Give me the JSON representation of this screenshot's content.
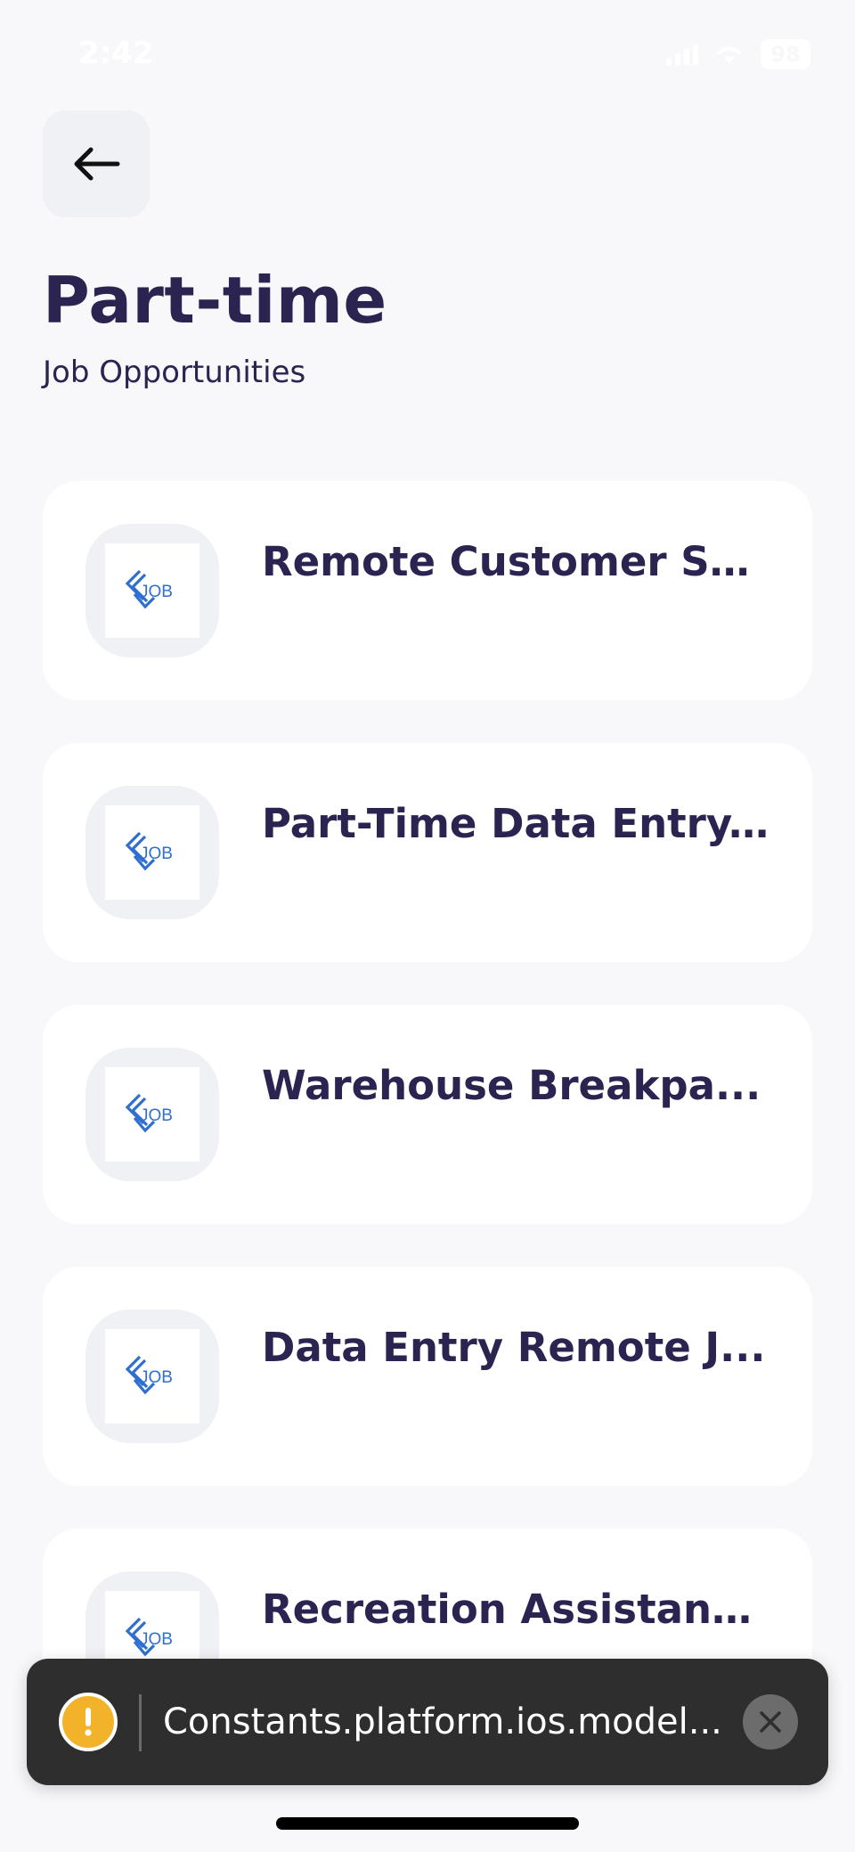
{
  "status_bar": {
    "time": "2:42",
    "battery": "98"
  },
  "header": {
    "title": "Part-time",
    "subtitle": "Job Opportunities"
  },
  "jobs": [
    {
      "title": "Remote Customer Se...",
      "logo": "JOB"
    },
    {
      "title": "Part-Time Data Entry...",
      "logo": "JOB"
    },
    {
      "title": "Warehouse Breakpa...",
      "logo": "JOB"
    },
    {
      "title": "Data Entry Remote J...",
      "logo": "JOB"
    },
    {
      "title": "Recreation Assistant...",
      "logo": "JOB"
    }
  ],
  "toast": {
    "message": "Constants.platform.ios.model..."
  },
  "colors": {
    "background": "#f8f8fb",
    "primary_text": "#2b2450",
    "accent_logo": "#2f6fd0",
    "warning": "#f2b32b",
    "toast_bg": "#2e2e2e"
  },
  "icons": {
    "back": "arrow-left-icon",
    "warning": "exclamation-icon",
    "close": "close-icon",
    "logo": "job-logo-icon"
  }
}
